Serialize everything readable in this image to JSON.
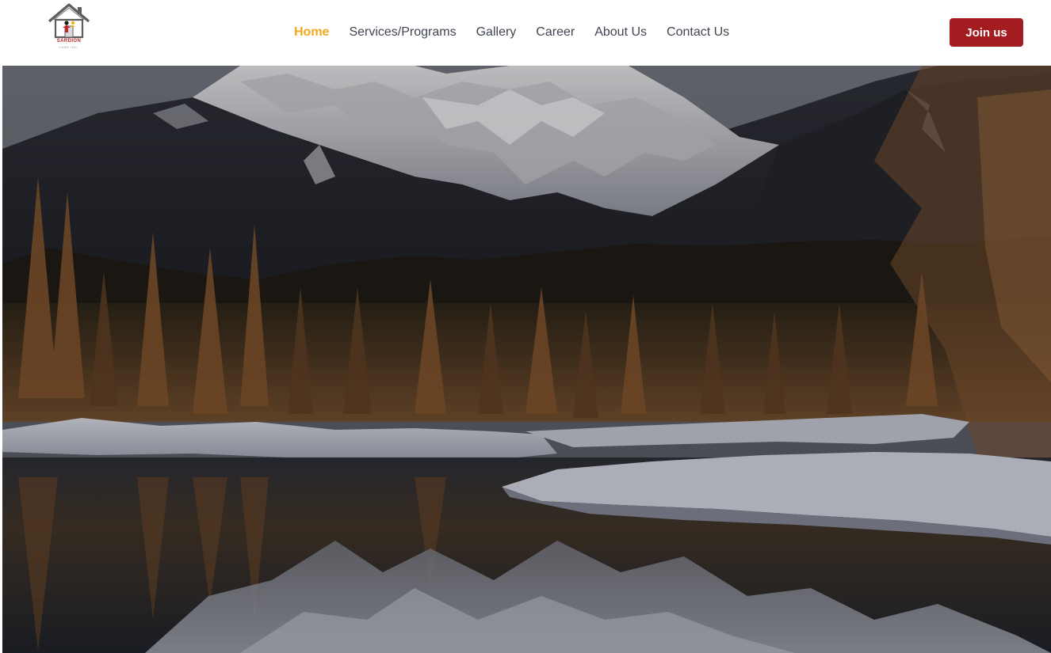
{
  "header": {
    "logo": {
      "name": "SARDION",
      "tagline": "CARE INC."
    },
    "nav": [
      {
        "label": "Home",
        "active": true
      },
      {
        "label": "Services/Programs",
        "active": false
      },
      {
        "label": "Gallery",
        "active": false
      },
      {
        "label": "Career",
        "active": false
      },
      {
        "label": "About Us",
        "active": false
      },
      {
        "label": "Contact Us",
        "active": false
      }
    ],
    "cta_label": "Join us"
  },
  "hero": {
    "image": "mountain-lake-winter-photo"
  },
  "colors": {
    "accent": "#f2a81d",
    "brand": "#a31c1f",
    "nav_text": "#3f4651"
  }
}
